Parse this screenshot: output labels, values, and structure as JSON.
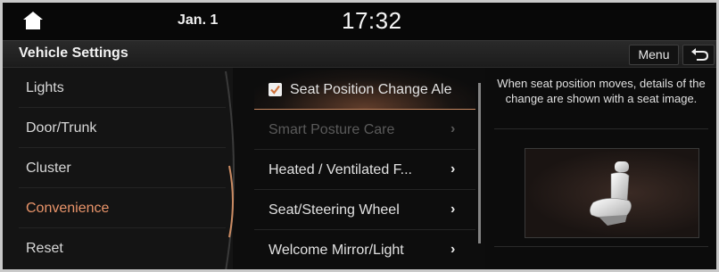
{
  "status": {
    "date": "Jan. 1",
    "time": "17:32"
  },
  "header": {
    "title": "Vehicle Settings",
    "menu_label": "Menu"
  },
  "categories": [
    {
      "label": "Lights",
      "active": false
    },
    {
      "label": "Door/Trunk",
      "active": false
    },
    {
      "label": "Cluster",
      "active": false
    },
    {
      "label": "Convenience",
      "active": true
    },
    {
      "label": "Reset",
      "active": false
    }
  ],
  "options": [
    {
      "label": "Seat Position Change Ale",
      "checked": true,
      "selected": true,
      "disabled": false,
      "chevron": ""
    },
    {
      "label": "Smart Posture Care",
      "checked": false,
      "selected": false,
      "disabled": true,
      "chevron": "›"
    },
    {
      "label": "Heated / Ventilated F...",
      "checked": false,
      "selected": false,
      "disabled": false,
      "chevron": "›"
    },
    {
      "label": "Seat/Steering Wheel",
      "checked": false,
      "selected": false,
      "disabled": false,
      "chevron": "›"
    },
    {
      "label": "Welcome Mirror/Light",
      "checked": false,
      "selected": false,
      "disabled": false,
      "chevron": "›"
    }
  ],
  "info": {
    "description": "When seat position moves, details of the change are shown with a seat image.",
    "image_icon": "seat-icon"
  },
  "colors": {
    "accent": "#e9946a",
    "background": "#0d0d0d",
    "disabled": "#5a5a5a"
  }
}
